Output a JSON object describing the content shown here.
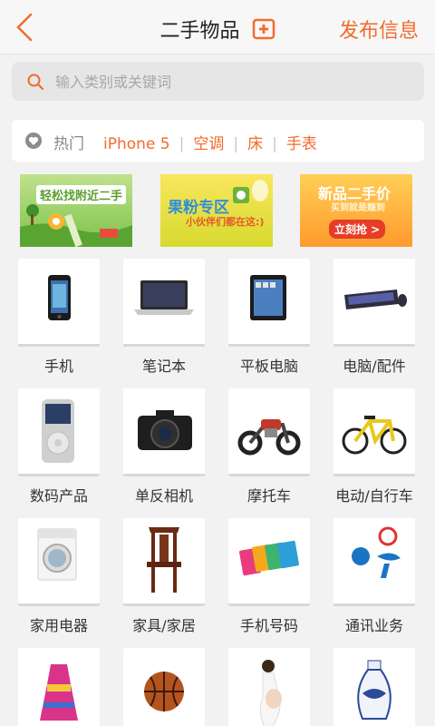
{
  "header": {
    "back": "back-arrow-icon",
    "title": "二手物品",
    "title_icon": "add-square-icon",
    "publish_label": "发布信息"
  },
  "search": {
    "placeholder": "输入类别或关键词",
    "icon": "search-icon"
  },
  "hot": {
    "icon": "heart-icon",
    "label": "热门",
    "items": [
      "iPhone 5",
      "空调",
      "床",
      "手表"
    ],
    "separator": "|"
  },
  "banners": [
    {
      "text": "轻松找附近二手"
    },
    {
      "text": "果粉专区",
      "sub": "小伙伴们都在这:)"
    },
    {
      "text": "新品二手价",
      "sub": "买到就是赚到",
      "cta": "立刻抢 >"
    }
  ],
  "categories": [
    {
      "label": "手机",
      "icon": "mobile-phone-icon"
    },
    {
      "label": "笔记本",
      "icon": "laptop-icon"
    },
    {
      "label": "平板电脑",
      "icon": "tablet-icon"
    },
    {
      "label": "电脑/配件",
      "icon": "keyboard-icon"
    },
    {
      "label": "数码产品",
      "icon": "mp3-player-icon"
    },
    {
      "label": "单反相机",
      "icon": "dslr-camera-icon"
    },
    {
      "label": "摩托车",
      "icon": "motorcycle-icon"
    },
    {
      "label": "电动/自行车",
      "icon": "bicycle-icon"
    },
    {
      "label": "家用电器",
      "icon": "washing-machine-icon"
    },
    {
      "label": "家具/家居",
      "icon": "chair-icon"
    },
    {
      "label": "手机号码",
      "icon": "sim-card-icon"
    },
    {
      "label": "通讯业务",
      "icon": "telecom-logo-icon"
    },
    {
      "label": "",
      "icon": "dress-icon"
    },
    {
      "label": "",
      "icon": "basketball-icon"
    },
    {
      "label": "",
      "icon": "maternity-icon"
    },
    {
      "label": "",
      "icon": "vase-icon"
    }
  ],
  "colors": {
    "accent": "#f26b2c",
    "background": "#f2f2f2"
  }
}
